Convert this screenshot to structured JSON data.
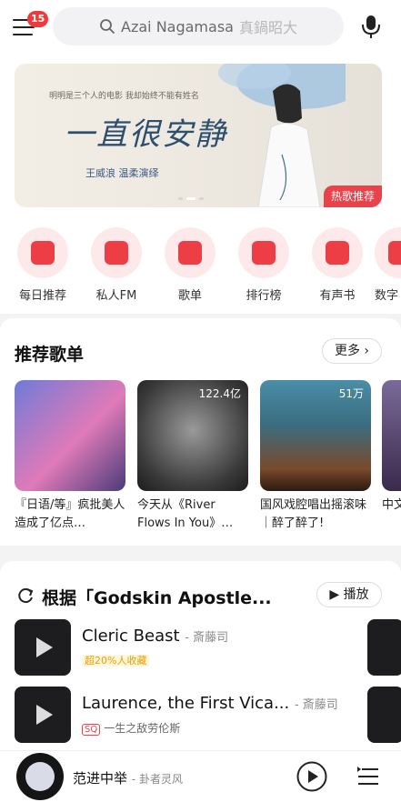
{
  "header": {
    "notification_count": "15",
    "search_placeholder": "Azai Nagamasa",
    "search_hint": "真鍋昭大"
  },
  "banner": {
    "subtitle": "明明是三个人的电影 我却始终不能有姓名",
    "title": "一直很安静",
    "credit": "王威浪 温柔演绎",
    "tag": "热歌推荐"
  },
  "quick_entries": [
    {
      "label": "每日推荐",
      "icon": "calendar-icon"
    },
    {
      "label": "私人FM",
      "icon": "radio-icon"
    },
    {
      "label": "歌单",
      "icon": "playlist-icon"
    },
    {
      "label": "排行榜",
      "icon": "chart-icon"
    },
    {
      "label": "有声书",
      "icon": "book-icon"
    },
    {
      "label": "数字",
      "icon": "album-icon"
    }
  ],
  "recommended": {
    "title": "推荐歌单",
    "more_label": "更多",
    "playlists": [
      {
        "title": "『日语/等』疯批美人造成了亿点…",
        "plays": ""
      },
      {
        "title": "今天从《River Flows In You》…",
        "plays": "122.4亿"
      },
      {
        "title": "国风戏腔唱出摇滚味｜醉了醉了!",
        "plays": "51万"
      },
      {
        "title": "中文精选",
        "plays": ""
      }
    ]
  },
  "song_section": {
    "title": "根据「Godskin Apostle...",
    "play_label": "播放",
    "songs": [
      {
        "name": "Cleric Beast",
        "artist": "- 斎藤司",
        "tag": "超20%人收藏",
        "badge": "",
        "desc": ""
      },
      {
        "name": "Laurence, the First Vica...",
        "artist": "- 斎藤司",
        "tag": "",
        "badge": "SQ",
        "desc": "一生之敌劳伦斯"
      }
    ]
  },
  "player": {
    "title": "范进中举",
    "artist": "- 卦者灵风"
  }
}
